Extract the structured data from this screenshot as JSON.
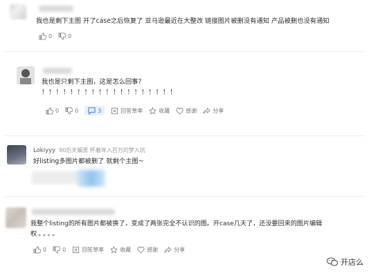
{
  "comments": [
    {
      "text": "我也是剩下主图  开了case之后恢复了  亚马逊最近在大整改  链接图片被删没有通知  产品被删也没有通知",
      "likes": "0",
      "dislikes": "0"
    },
    {
      "text": "我也是只剩下主图，这是怎么回事?",
      "text2": "！！！！！！！！！！！！！！！！！！！",
      "likes": "0",
      "dislikes": "0",
      "replies": "3",
      "labels": [
        "回答草率",
        "收藏",
        "感谢",
        "分享"
      ]
    },
    {
      "username": "Lokiyyy",
      "meta": "90后天蝎男  怀着年入百万的梦入坑",
      "text": "好listing多图片都被删了  就剩个主图~"
    },
    {
      "text": "我整个listing的所有图片都被换了，变成了两张完全不认识的图。开case几天了，还没要回来的图片编辑",
      "text2": "权。。。。",
      "likes": "0",
      "dislikes": "0",
      "labels": [
        "回答草率",
        "收藏",
        "感谢",
        "分享"
      ]
    }
  ],
  "watermark": "开店么"
}
